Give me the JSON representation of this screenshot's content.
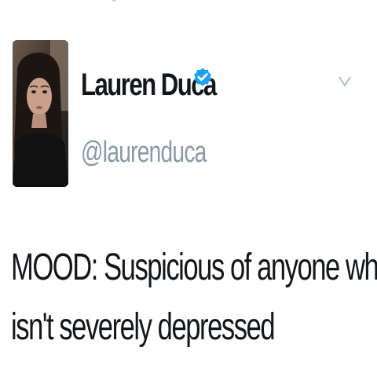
{
  "tweet": {
    "author": {
      "name": "Lauren Duca",
      "handle": "@laurenduca",
      "verified": true,
      "avatar": "profile-photo"
    },
    "menu_icon": "chevron-down-icon",
    "verified_icon": "verified-badge-icon",
    "text_lines": [
      "MOOD: Suspicious of anyone who",
      "isn't severely depressed"
    ]
  },
  "colors": {
    "text": "#14171a",
    "muted": "#8899a6",
    "verified": "#1da1f2",
    "background": "#ffffff"
  }
}
